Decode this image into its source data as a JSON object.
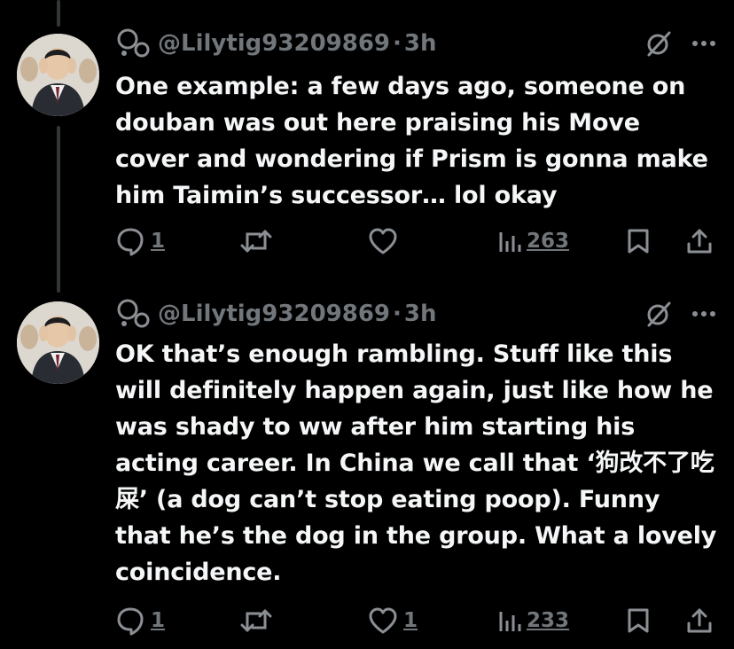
{
  "tweets": [
    {
      "handle": "@Lilytig93209869",
      "separator": "·",
      "time": "3h",
      "text": "One example: a few days ago, someone on douban was out here praising his Move cover and wondering if Prism is gonna make him Taimin’s successor… lol okay",
      "replies": "1",
      "retweets": "",
      "likes": "",
      "views": "263"
    },
    {
      "handle": "@Lilytig93209869",
      "separator": "·",
      "time": "3h",
      "text": "OK that’s enough rambling. Stuff like this will definitely happen again, just like how he was shady to ww after him starting his acting career. In China we call that ‘狗改不了吃屎’ (a dog can’t stop eating poop). Funny that he’s the dog in the group. What a lovely coincidence.",
      "replies": "1",
      "retweets": "",
      "likes": "1",
      "views": "233"
    }
  ],
  "icons": {
    "reply": "reply-bubble-icon",
    "retweet": "retweet-arrows-icon",
    "like": "heart-icon",
    "views": "analytics-bars-icon",
    "bookmark": "bookmark-icon",
    "share": "share-upload-icon",
    "grok": "grok-slash-icon",
    "more": "more-dots-icon"
  },
  "colors": {
    "background": "#000000",
    "text": "#e7e9ea",
    "muted": "#71767b",
    "thread_line": "#333639"
  }
}
